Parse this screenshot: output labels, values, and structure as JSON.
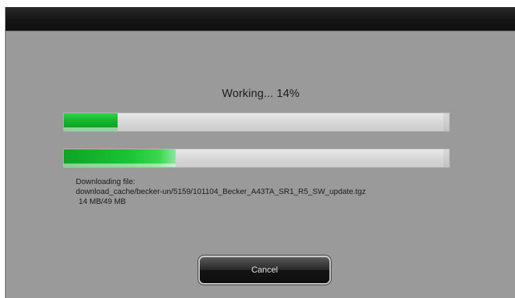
{
  "status": {
    "title": "Working... 14%"
  },
  "progress": {
    "overall_fraction": 0.14,
    "download_fraction": 0.29
  },
  "download": {
    "label": "Downloading file:",
    "path": "download_cache/becker-un/5159/101104_Becker_A43TA_SR1_R5_SW_update.tgz",
    "size": "14 MB/49 MB"
  },
  "buttons": {
    "cancel_label": "Cancel"
  },
  "colors": {
    "background": "#9a9a9a",
    "titlebar": "#151515",
    "progress_fill": "#13b52a"
  }
}
